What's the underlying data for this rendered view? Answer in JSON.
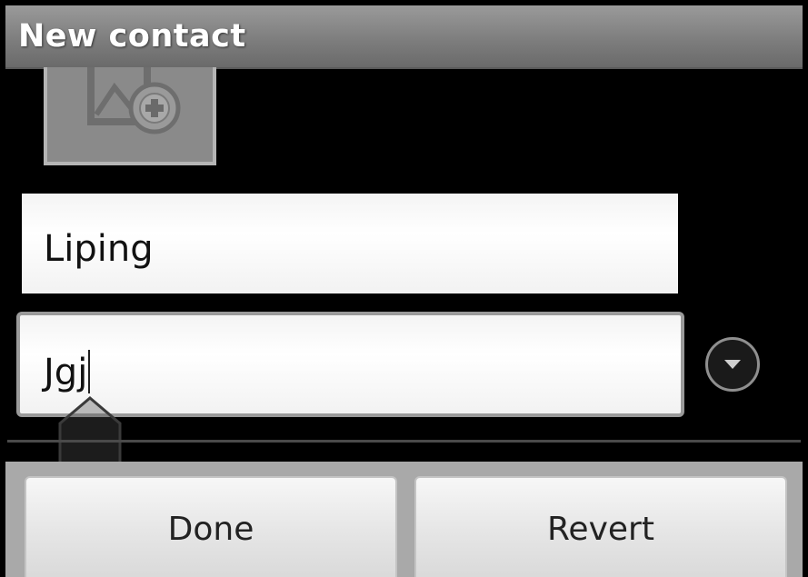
{
  "titlebar": {
    "title": "New contact"
  },
  "photo": {
    "icon": "add-photo-icon"
  },
  "fields": {
    "first_value": "Liping",
    "second_value": "Jgj"
  },
  "expand": {
    "icon": "chevron-down-icon"
  },
  "buttons": {
    "done_label": "Done",
    "revert_label": "Revert"
  }
}
